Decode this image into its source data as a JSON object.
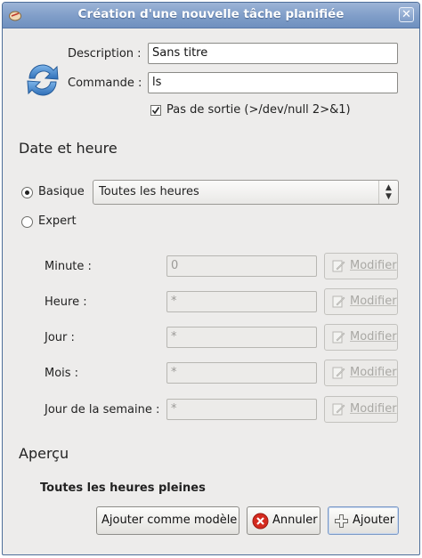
{
  "window": {
    "title": "Création d'une nouvelle tâche planifiée",
    "app_icon": "gnome-schedule-icon",
    "close_glyph": "✕"
  },
  "form": {
    "description_label": "Description :",
    "description_value": "Sans titre",
    "command_label": "Commande :",
    "command_value": "ls",
    "no_output_label": "Pas de sortie (>/dev/null 2>&1)",
    "no_output_checked": true,
    "task_icon": "refresh-arrows-icon"
  },
  "date": {
    "section_title": "Date et heure",
    "basic_label": "Basique",
    "expert_label": "Expert",
    "selected_mode": "Basique",
    "basic_selected_option": "Toutes les heures"
  },
  "fields": [
    {
      "label": "Minute :",
      "value": "0",
      "button": "Modifier"
    },
    {
      "label": "Heure :",
      "value": "*",
      "button": "Modifier"
    },
    {
      "label": "Jour :",
      "value": "*",
      "button": "Modifier"
    },
    {
      "label": "Mois :",
      "value": "*",
      "button": "Modifier"
    },
    {
      "label": "Jour de la semaine :",
      "value": "*",
      "button": "Modifier"
    }
  ],
  "preview": {
    "section_title": "Aperçu",
    "text": "Toutes les heures pleines"
  },
  "buttons": {
    "template": "Ajouter comme modèle",
    "cancel": "Annuler",
    "add": "Ajouter"
  },
  "colors": {
    "titlebar": "#7f9dc8",
    "cancel_icon": "#d42a1e",
    "icon_blue": "#3f86cf"
  }
}
